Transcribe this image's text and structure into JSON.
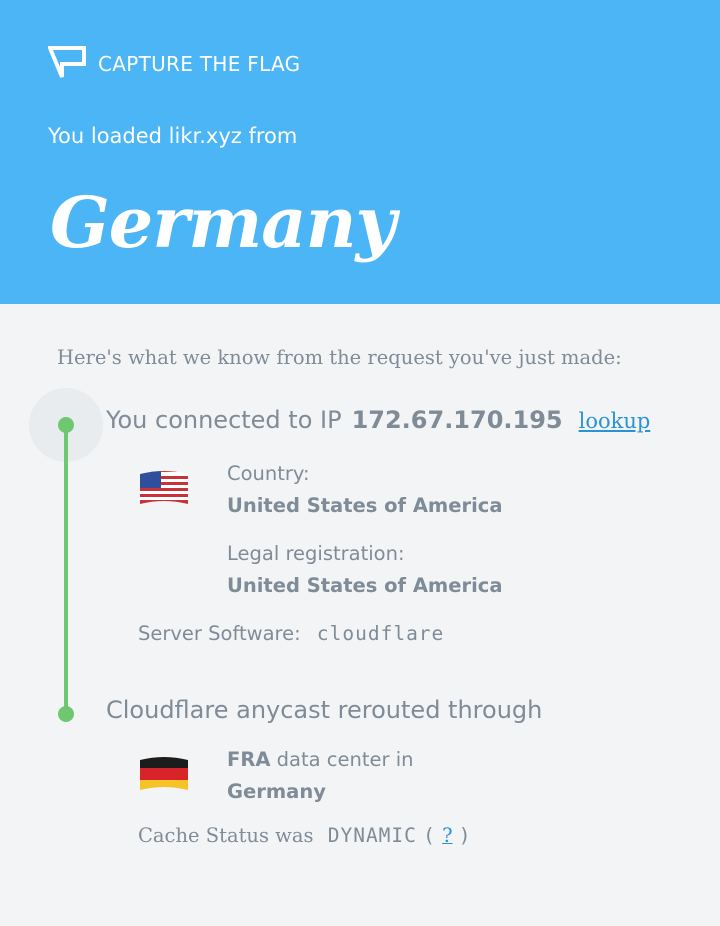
{
  "header": {
    "brand_text": "CAPTURE THE FLAG",
    "loaded_text": "You loaded likr.xyz from",
    "country": "Germany"
  },
  "intro": "Here's what we know from the request you've just made:",
  "connection": {
    "prefix": "You connected to IP",
    "ip": "172.67.170.195",
    "lookup_label": "lookup",
    "country_label": "Country:",
    "country_value": "United States of America",
    "legal_label": "Legal registration:",
    "legal_value": "United States of America",
    "server_label": "Server Software:",
    "server_value": "cloudflare"
  },
  "anycast": {
    "heading": "Cloudflare anycast rerouted through",
    "datacenter_code": "FRA",
    "datacenter_suffix": "data center in",
    "datacenter_country": "Germany",
    "cache_label": "Cache Status was",
    "cache_value": "DYNAMIC",
    "help_open": "(",
    "help_label": "?",
    "help_close": ")"
  },
  "colors": {
    "header_bg": "#4bb5f6",
    "timeline": "#6dc86f",
    "link": "#2a93d6",
    "text_muted": "#7f8b97"
  }
}
